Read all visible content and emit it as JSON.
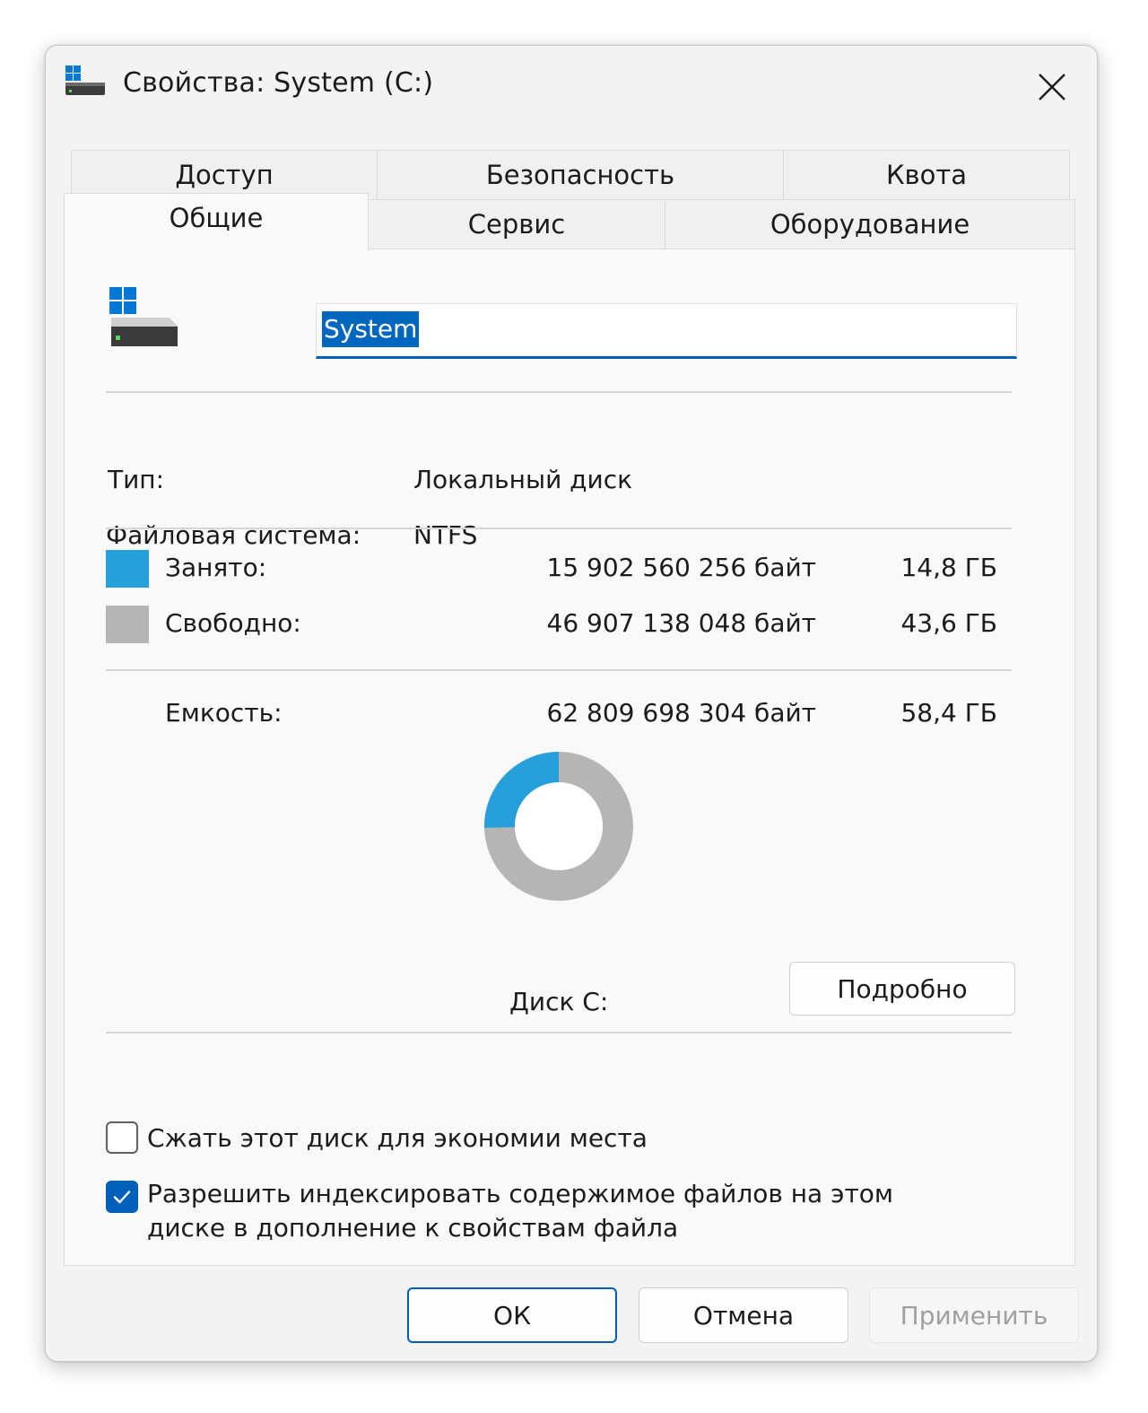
{
  "window": {
    "title": "Свойства: System (C:)"
  },
  "tabs": {
    "row_back": [
      {
        "label": "Доступ"
      },
      {
        "label": "Безопасность"
      },
      {
        "label": "Квота"
      }
    ],
    "row_front": [
      {
        "label": "Общие",
        "active": true
      },
      {
        "label": "Сервис"
      },
      {
        "label": "Оборудование"
      }
    ]
  },
  "general": {
    "volume_name": "System",
    "type_label": "Тип:",
    "type_value": "Локальный диск",
    "fs_label": "Файловая система:",
    "fs_value": "NTFS",
    "used": {
      "label": "Занято:",
      "bytes": "15 902 560 256 байт",
      "size": "14,8 ГБ",
      "color": "#26a0da"
    },
    "free": {
      "label": "Свободно:",
      "bytes": "46 907 138 048 байт",
      "size": "43,6 ГБ",
      "color": "#b5b5b5"
    },
    "capacity": {
      "label": "Емкость:",
      "bytes": "62 809 698 304 байт",
      "size": "58,4 ГБ"
    },
    "used_fraction": 0.2532,
    "disk_label": "Диск C:",
    "details_button": "Подробно",
    "compress_label": "Сжать этот диск для экономии места",
    "compress_checked": false,
    "index_label_line1": "Разрешить индексировать содержимое файлов на этом",
    "index_label_line2": "диске в дополнение к свойствам файла",
    "index_checked": true
  },
  "buttons": {
    "ok": "ОК",
    "cancel": "Отмена",
    "apply": "Применить"
  },
  "icons": {
    "title": "drive-icon",
    "close": "close-icon",
    "drive": "windows-drive-icon",
    "check": "checkmark-icon"
  }
}
